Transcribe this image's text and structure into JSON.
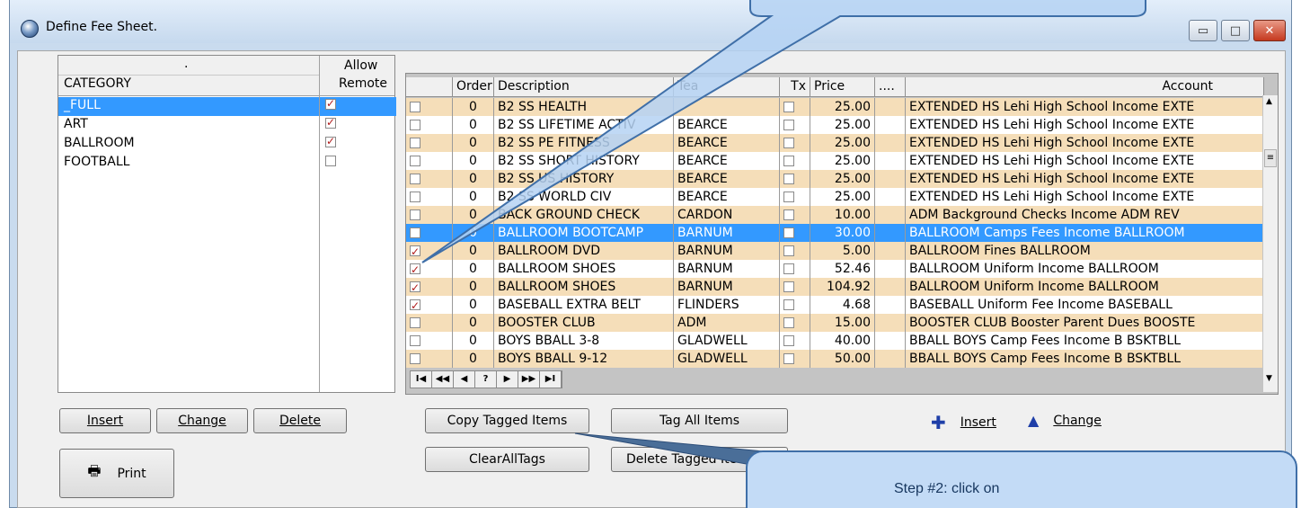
{
  "window": {
    "title": "Define Fee Sheet.",
    "minimize_glyph": "▭",
    "maximize_glyph": "□",
    "close_glyph": "✕"
  },
  "categories": {
    "header_dot": ".",
    "col_category": "CATEGORY",
    "col_allow_line1": "Allow",
    "col_allow_line2": "Remote",
    "rows": [
      {
        "name": "_FULL",
        "allow": true
      },
      {
        "name": "ART",
        "allow": true
      },
      {
        "name": "BALLROOM",
        "allow": true
      },
      {
        "name": "FOOTBALL",
        "allow": false
      }
    ],
    "buttons": {
      "insert": "Insert",
      "change": "Change",
      "delete": "Delete",
      "print": "Print"
    }
  },
  "fees": {
    "columns": {
      "order": "Order",
      "description": "Description",
      "teacher": "Tea",
      "tx": "Tx",
      "price": "Price",
      "more": "....",
      "account": "Account"
    },
    "rows": [
      {
        "tag": false,
        "order": "0",
        "description": "B2 SS HEALTH",
        "teacher": "",
        "tx": false,
        "price": "25.00",
        "account": "EXTENDED HS Lehi High School Income EXTE",
        "style": "tan"
      },
      {
        "tag": false,
        "order": "0",
        "description": "B2 SS LIFETIME ACTIV",
        "teacher": "BEARCE",
        "tx": false,
        "price": "25.00",
        "account": "EXTENDED HS Lehi High School Income EXTE",
        "style": "white"
      },
      {
        "tag": false,
        "order": "0",
        "description": "B2 SS PE FITNESS",
        "teacher": "BEARCE",
        "tx": false,
        "price": "25.00",
        "account": "EXTENDED HS Lehi High School Income EXTE",
        "style": "tan"
      },
      {
        "tag": false,
        "order": "0",
        "description": "B2 SS SHORT HISTORY",
        "teacher": "BEARCE",
        "tx": false,
        "price": "25.00",
        "account": "EXTENDED HS Lehi High School Income EXTE",
        "style": "white"
      },
      {
        "tag": false,
        "order": "0",
        "description": "B2 SS US HISTORY",
        "teacher": "BEARCE",
        "tx": false,
        "price": "25.00",
        "account": "EXTENDED HS Lehi High School Income EXTE",
        "style": "tan"
      },
      {
        "tag": false,
        "order": "0",
        "description": "B2 SS WORLD CIV",
        "teacher": "BEARCE",
        "tx": false,
        "price": "25.00",
        "account": "EXTENDED HS Lehi High School Income EXTE",
        "style": "white"
      },
      {
        "tag": false,
        "order": "0",
        "description": "BACK GROUND CHECK",
        "teacher": "CARDON",
        "tx": false,
        "price": "10.00",
        "account": "ADM Background Checks Income ADM REV",
        "style": "tan"
      },
      {
        "tag": false,
        "order": "0",
        "description": "BALLROOM BOOTCAMP",
        "teacher": "BARNUM",
        "tx": false,
        "price": "30.00",
        "account": "BALLROOM Camps Fees Income BALLROOM",
        "style": "sel"
      },
      {
        "tag": true,
        "order": "0",
        "description": "BALLROOM DVD",
        "teacher": "BARNUM",
        "tx": false,
        "price": "5.00",
        "account": "BALLROOM Fines BALLROOM",
        "style": "tan"
      },
      {
        "tag": true,
        "order": "0",
        "description": "BALLROOM SHOES",
        "teacher": "BARNUM",
        "tx": false,
        "price": "52.46",
        "account": "BALLROOM Uniform Income BALLROOM",
        "style": "white"
      },
      {
        "tag": true,
        "order": "0",
        "description": "BALLROOM SHOES",
        "teacher": "BARNUM",
        "tx": false,
        "price": "104.92",
        "account": "BALLROOM Uniform Income BALLROOM",
        "style": "tan"
      },
      {
        "tag": true,
        "order": "0",
        "description": "BASEBALL EXTRA BELT",
        "teacher": "FLINDERS",
        "tx": false,
        "price": "4.68",
        "account": "BASEBALL Uniform Fee Income BASEBALL",
        "style": "white"
      },
      {
        "tag": false,
        "order": "0",
        "description": "BOOSTER CLUB",
        "teacher": "ADM",
        "tx": false,
        "price": "15.00",
        "account": "BOOSTER CLUB Booster Parent Dues BOOSTE",
        "style": "tan"
      },
      {
        "tag": false,
        "order": "0",
        "description": "BOYS BBALL 3-8",
        "teacher": "GLADWELL",
        "tx": false,
        "price": "40.00",
        "account": "BBALL BOYS Camp Fees Income B BSKTBLL",
        "style": "white"
      },
      {
        "tag": false,
        "order": "0",
        "description": "BOYS BBALL 9-12",
        "teacher": "GLADWELL",
        "tx": false,
        "price": "50.00",
        "account": "BBALL BOYS Camp Fees Income B BSKTBLL",
        "style": "tan"
      }
    ],
    "nav": [
      "I◀",
      "◀◀",
      "◀",
      "?",
      "▶",
      "▶▶",
      "▶I"
    ],
    "buttons": {
      "copy_tagged": "Copy Tagged Items",
      "tag_all": "Tag All Items",
      "clear_all": "ClearAllTags",
      "delete_tagged": "Delete Tagged Ite"
    },
    "actions": {
      "insert": "Insert",
      "change": "Change"
    }
  },
  "callouts": {
    "step2": "Step #2:  click on"
  },
  "colors": {
    "tan_row": "#f5deb9",
    "selected_row": "#3399ff",
    "check_red": "#b01a1a",
    "insert_icon": "#1f3fa8"
  }
}
